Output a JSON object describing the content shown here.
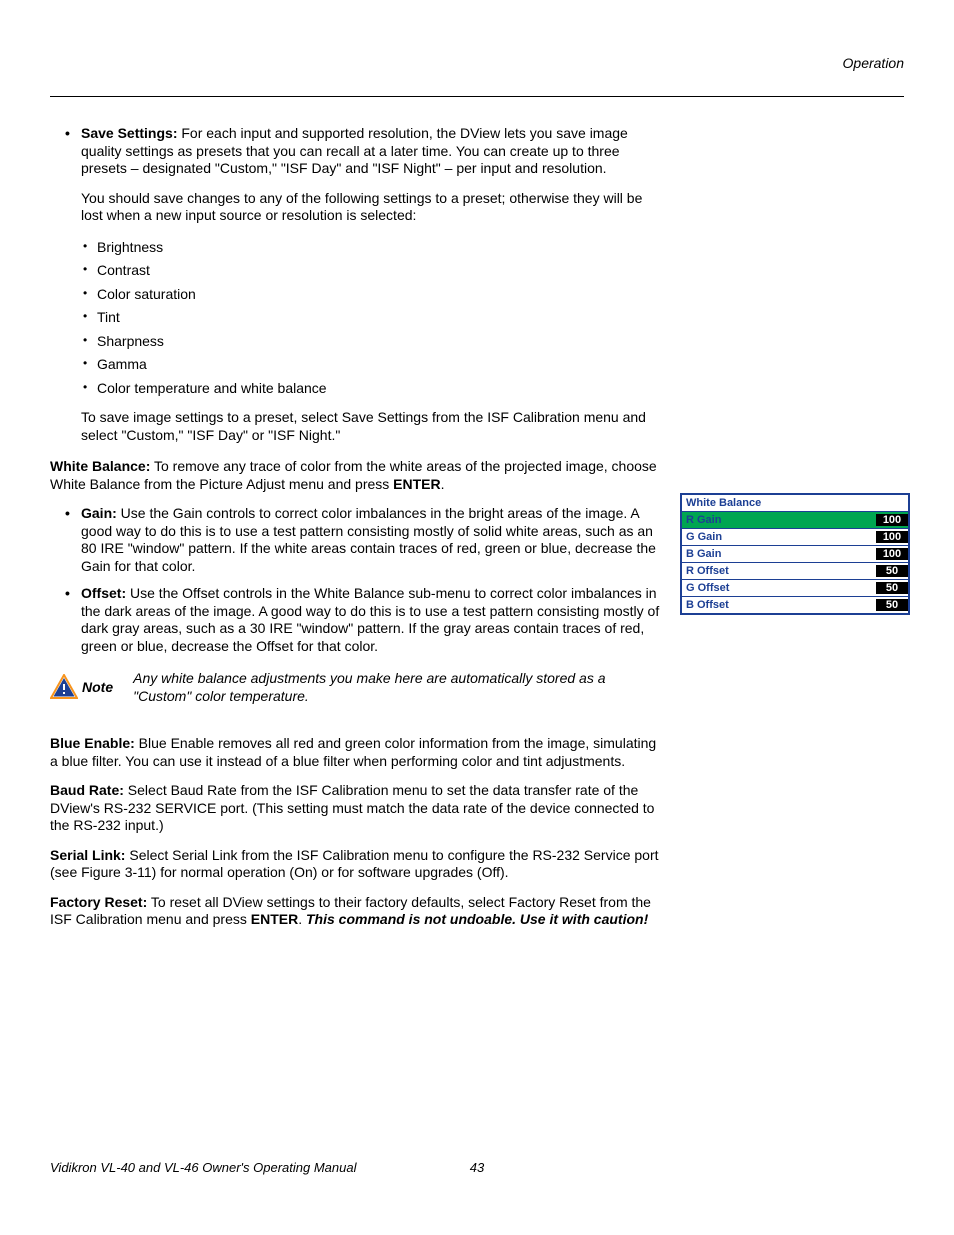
{
  "header": {
    "section": "Operation"
  },
  "save_settings": {
    "label": "Save Settings:",
    "p1": " For each input and supported resolution, the DView lets you save image quality settings as presets that you can recall at a later time. You can create up to three presets – designated \"Custom,\" \"ISF Day\" and \"ISF Night\" – per input and resolution.",
    "p2": "You should save changes to any of the following settings to a preset; otherwise they will be lost when a new input source or resolution is selected:",
    "list": [
      "Brightness",
      "Contrast",
      "Color saturation",
      "Tint",
      "Sharpness",
      "Gamma",
      "Color temperature and white balance"
    ],
    "p3": "To save image settings to a preset, select Save Settings from the ISF Calibration menu and select \"Custom,\" \"ISF Day\" or \"ISF Night.\""
  },
  "white_balance": {
    "label": "White Balance:",
    "p1a": " To remove any trace of color from the white areas of the projected image, choose White Balance from the Picture Adjust menu and press ",
    "enter": "ENTER",
    "p1b": ".",
    "gain_label": "Gain:",
    "gain_text": " Use the Gain controls to correct color imbalances in the bright areas of the image. A good way to do this is to use a test pattern consisting mostly of solid white areas, such as an 80 IRE \"window\" pattern. If the white areas contain traces of red, green or blue, decrease the Gain for that color.",
    "offset_label": "Offset:",
    "offset_text": " Use the Offset controls in the White Balance sub-menu to correct color imbalances in the dark areas of the image. A good way to do this is to use a test pattern consisting mostly of dark gray areas, such as a 30 IRE \"window\" pattern. If the gray areas contain traces of red, green or blue, decrease the Offset for that color."
  },
  "note": {
    "label": "Note",
    "text": "Any white balance adjustments you make here are automatically stored as a \"Custom\" color temperature."
  },
  "blue_enable": {
    "label": "Blue Enable:",
    "text": " Blue Enable removes all red and green color information from the image, simulating a blue filter. You can use it instead of a blue filter when performing color and tint adjustments."
  },
  "baud_rate": {
    "label": "Baud Rate:",
    "text": " Select Baud Rate from the ISF Calibration menu to set the data transfer rate of the DView's RS-232 SERVICE port. (This setting must match the data rate of the device connected to the RS-232 input.)"
  },
  "serial_link": {
    "label": "Serial Link:",
    "text": " Select Serial Link from the ISF Calibration menu to configure the RS-232 Service port (see Figure 3-11) for normal operation (On) or for software upgrades (Off)."
  },
  "factory_reset": {
    "label": "Factory Reset:",
    "t1": " To reset all DView settings to their factory defaults, select Factory Reset from the ISF Calibration menu and press ",
    "enter": "ENTER",
    "t2": ". ",
    "warn": "This command is not undoable. Use it with caution!"
  },
  "wb_table": {
    "title": "White Balance",
    "rows": [
      {
        "label": "R Gain",
        "value": "100",
        "selected": true
      },
      {
        "label": "G Gain",
        "value": "100",
        "selected": false
      },
      {
        "label": "B Gain",
        "value": "100",
        "selected": false
      },
      {
        "label": "R Offset",
        "value": "50",
        "selected": false
      },
      {
        "label": "G Offset",
        "value": "50",
        "selected": false
      },
      {
        "label": "B Offset",
        "value": "50",
        "selected": false
      }
    ]
  },
  "footer": {
    "title": "Vidikron VL-40 and VL-46 Owner's Operating Manual",
    "page": "43"
  }
}
